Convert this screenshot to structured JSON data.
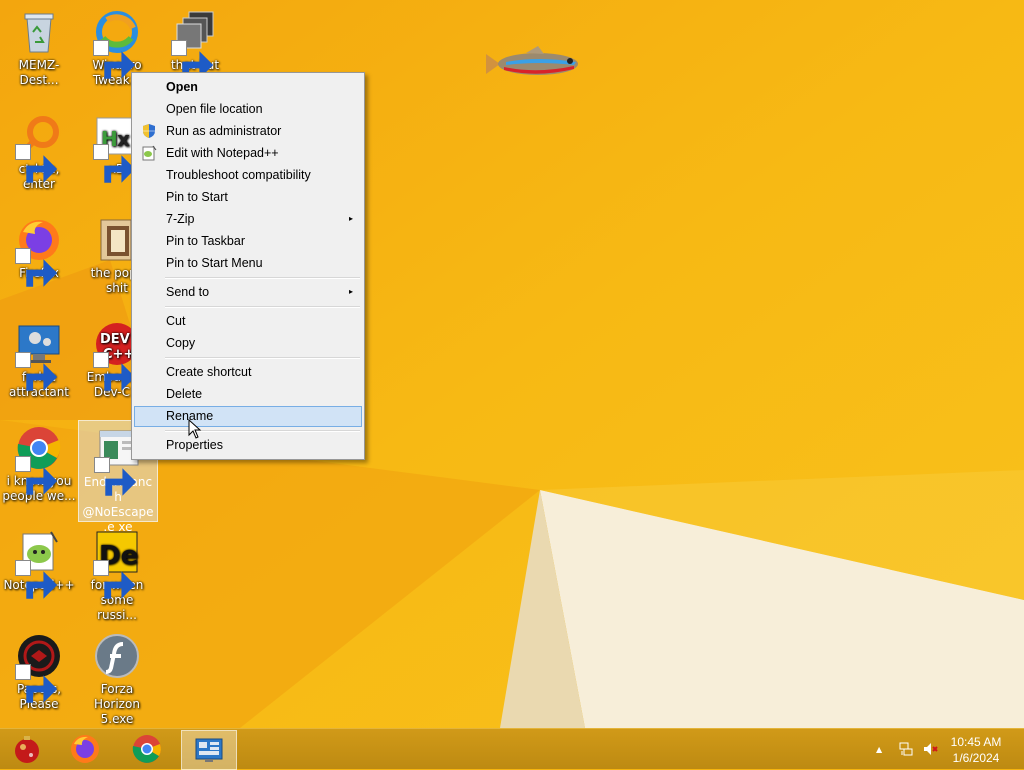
{
  "desktop": {
    "icons": [
      {
        "label": "MEMZ-Dest...",
        "icon": "recycle-bin"
      },
      {
        "label": "Winaero Tweak...",
        "icon": "winaero"
      },
      {
        "label": "that but when",
        "icon": "windows-stack"
      },
      {
        "label": "ctrl+a, enter",
        "icon": "search-orange"
      },
      {
        "label": "xD",
        "icon": "hxd"
      },
      {
        "label": "Firefox",
        "icon": "firefox"
      },
      {
        "label": "the popc shit",
        "icon": "folder-image"
      },
      {
        "label": "forkie attractant",
        "icon": "monitor-gear"
      },
      {
        "label": "Embarcad Dev-C+",
        "icon": "devcpp"
      },
      {
        "label": "i know you people we...",
        "icon": "chrome"
      },
      {
        "label": "Endermanch @NoEscape.e xe",
        "icon": "exe"
      },
      {
        "label": "Notepad++",
        "icon": "notepadpp"
      },
      {
        "label": "for when some russi...",
        "icon": "de-logo"
      },
      {
        "label": "Papers, Please",
        "icon": "papers-please"
      },
      {
        "label": "Forza Horizon 5.exe",
        "icon": "flash"
      }
    ]
  },
  "context_menu": {
    "items": [
      {
        "label": "Open"
      },
      {
        "label": "Open file location"
      },
      {
        "label": "Run as administrator"
      },
      {
        "label": "Edit with Notepad++"
      },
      {
        "label": "Troubleshoot compatibility"
      },
      {
        "label": "Pin to Start"
      },
      {
        "label": "7-Zip"
      },
      {
        "label": "Pin to Taskbar"
      },
      {
        "label": "Pin to Start Menu"
      },
      {
        "label": "Send to"
      },
      {
        "label": "Cut"
      },
      {
        "label": "Copy"
      },
      {
        "label": "Create shortcut"
      },
      {
        "label": "Delete"
      },
      {
        "label": "Rename"
      },
      {
        "label": "Properties"
      }
    ],
    "highlighted": "Rename",
    "submenu_arrow": "▸"
  },
  "taskbar": {
    "clock_time": "10:45 AM",
    "clock_date": "1/6/2024",
    "tray_arrow": "▲"
  },
  "colors": {
    "wallpaper_yellow": "#f5b40f",
    "taskbar": "#c9931a",
    "menu_bg": "#f0f0f0",
    "menu_highlight": "#d1e3f6"
  }
}
